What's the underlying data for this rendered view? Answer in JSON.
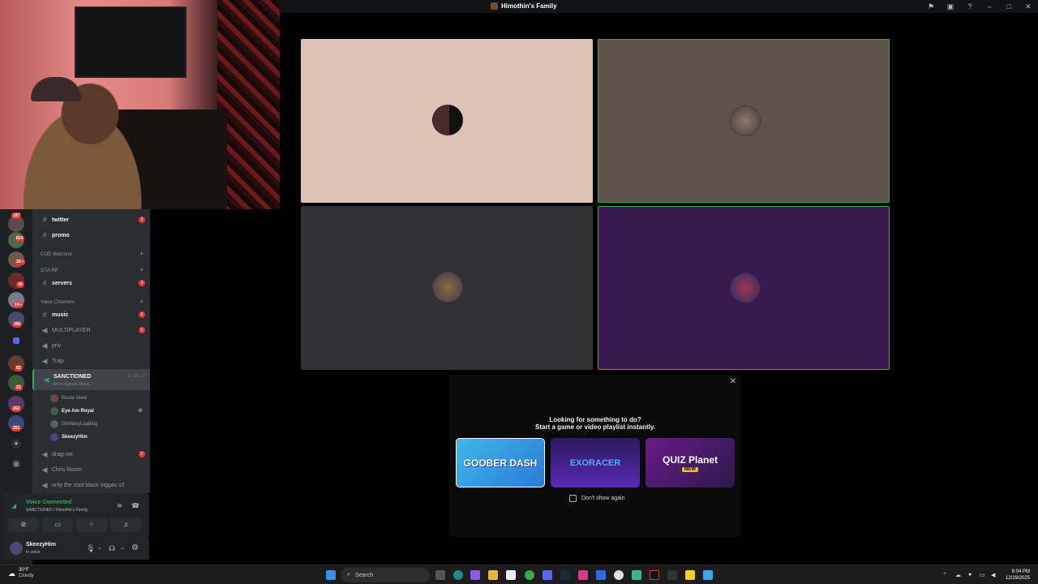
{
  "window": {
    "title": "Himothin's Family"
  },
  "channels": {
    "items": [
      {
        "label": "twitter",
        "badge": "2"
      },
      {
        "label": "promo"
      }
    ],
    "categories": [
      "COD Warzone",
      "GTA RP",
      "Voice Channels"
    ],
    "servers": {
      "label": "servers",
      "badge": "3"
    },
    "voice": [
      {
        "label": "music",
        "badge": "2"
      },
      {
        "label": "MULTIPLAYER",
        "badge": "2"
      },
      {
        "label": "priv"
      },
      {
        "label": "Trap"
      }
    ],
    "active": {
      "label": "SANCTIONED",
      "timer": "1:19:17",
      "status": "Set a channel status"
    },
    "members": [
      "Bouta skeet",
      "Eye Am Royal",
      "GloNavyLoading",
      "SkeezyHim"
    ],
    "more_voice": [
      "drag-me",
      "Chris Room",
      "only the cool black niggas v2"
    ],
    "drag_badge": "2"
  },
  "rail_badges": [
    "187",
    "824",
    "2K+",
    "38",
    "1K+",
    "395",
    "82",
    "23",
    "262",
    "251"
  ],
  "voice_panel": {
    "status": "Voice Connected",
    "location": "SANCTIONED / Himothin's Family"
  },
  "user_panel": {
    "name": "SkeezyHim",
    "status": "In voice"
  },
  "popup": {
    "heading": "Looking for something to do?",
    "subheading": "Start a game or video playlist instantly.",
    "games": [
      "GOOBER DASH",
      "EXORACER",
      "QUIZ Planet",
      "NEW"
    ],
    "checkbox": "Don't show again"
  },
  "taskbar": {
    "weather_temp": "30°F",
    "weather_desc": "Cloudy",
    "search": "Search",
    "time": "8:04 PM",
    "date": "12/29/2025"
  },
  "colors": {
    "tile1": "#dec3b5",
    "tile2": "#5e524b",
    "tile3": "#313133",
    "tile4": "#3a1a4e",
    "speaking": "#3ba55c"
  }
}
